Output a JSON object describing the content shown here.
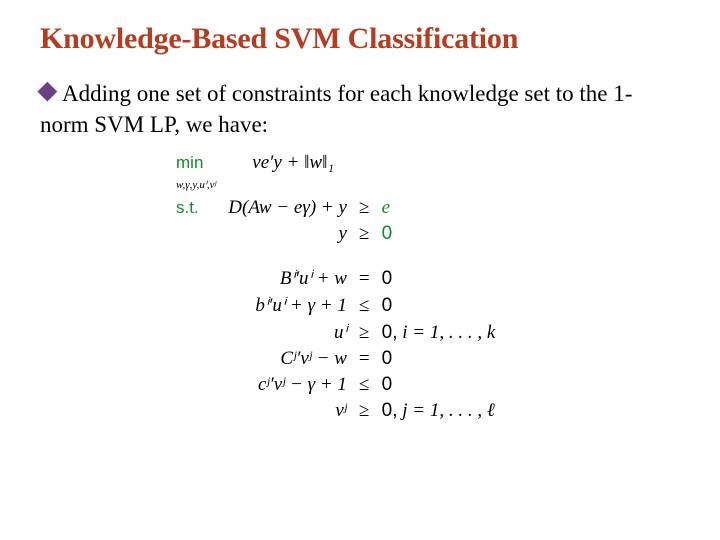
{
  "title": "Knowledge-Based SVM Classification",
  "body_text": "Adding one set of constraints for each knowledge set to the 1-norm SVM  LP, we have:",
  "math": {
    "min_label": "min",
    "min_sub": "w,γ,y,uⁱ,vʲ",
    "objective": "νe′y + ‖w‖₁",
    "st_label": "s.t.",
    "constraints": [
      {
        "lhs": "D(Aw − eγ) + y",
        "rel": "≥",
        "rhs": "e",
        "rhs_green": true,
        "tail": ""
      },
      {
        "lhs": "y",
        "rel": "≥",
        "rhs": "0",
        "rhs_green": true,
        "tail": ""
      }
    ],
    "knowledge_constraints": [
      {
        "lhs": "Bⁱ′uⁱ + w",
        "rel": "=",
        "rhs": "0",
        "tail": ""
      },
      {
        "lhs": "bⁱ′uⁱ + γ + 1",
        "rel": "≤",
        "rhs": "0",
        "tail": ""
      },
      {
        "lhs": "uⁱ",
        "rel": "≥",
        "rhs": "0,",
        "tail": " i = 1, . . . , k"
      },
      {
        "lhs": "Cʲ′vʲ − w",
        "rel": "=",
        "rhs": "0",
        "tail": ""
      },
      {
        "lhs": "cʲ′vʲ − γ + 1",
        "rel": "≤",
        "rhs": "0",
        "tail": ""
      },
      {
        "lhs": "vʲ",
        "rel": "≥",
        "rhs": "0,",
        "tail": " j = 1, . . . , ℓ"
      }
    ]
  }
}
